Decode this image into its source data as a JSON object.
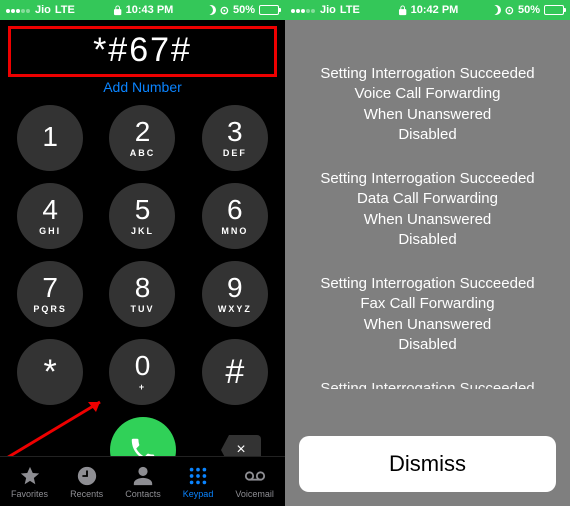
{
  "status_left": {
    "carrier": "Jio",
    "net": "LTE",
    "time": "10:43 PM",
    "battery": "50%"
  },
  "status_right": {
    "carrier": "Jio",
    "net": "LTE",
    "time": "10:42 PM",
    "battery": "50%"
  },
  "dialer": {
    "entry": "*#67#",
    "add_number": "Add Number",
    "keys": [
      {
        "d": "1",
        "s": ""
      },
      {
        "d": "2",
        "s": "ABC"
      },
      {
        "d": "3",
        "s": "DEF"
      },
      {
        "d": "4",
        "s": "GHI"
      },
      {
        "d": "5",
        "s": "JKL"
      },
      {
        "d": "6",
        "s": "MNO"
      },
      {
        "d": "7",
        "s": "PQRS"
      },
      {
        "d": "8",
        "s": "TUV"
      },
      {
        "d": "9",
        "s": "WXYZ"
      },
      {
        "d": "*",
        "s": ""
      },
      {
        "d": "0",
        "s": "+"
      },
      {
        "d": "#",
        "s": ""
      }
    ],
    "del": "×"
  },
  "tabs": {
    "favorites": "Favorites",
    "recents": "Recents",
    "contacts": "Contacts",
    "keypad": "Keypad",
    "voicemail": "Voicemail"
  },
  "alert": {
    "blocks": [
      [
        "Setting Interrogation Succeeded",
        "Voice Call Forwarding",
        "When Unanswered",
        "Disabled"
      ],
      [
        "Setting Interrogation Succeeded",
        "Data Call Forwarding",
        "When Unanswered",
        "Disabled"
      ],
      [
        "Setting Interrogation Succeeded",
        "Fax Call Forwarding",
        "When Unanswered",
        "Disabled"
      ]
    ],
    "cut": "Setting Interrogation Succeeded",
    "dismiss": "Dismiss"
  }
}
